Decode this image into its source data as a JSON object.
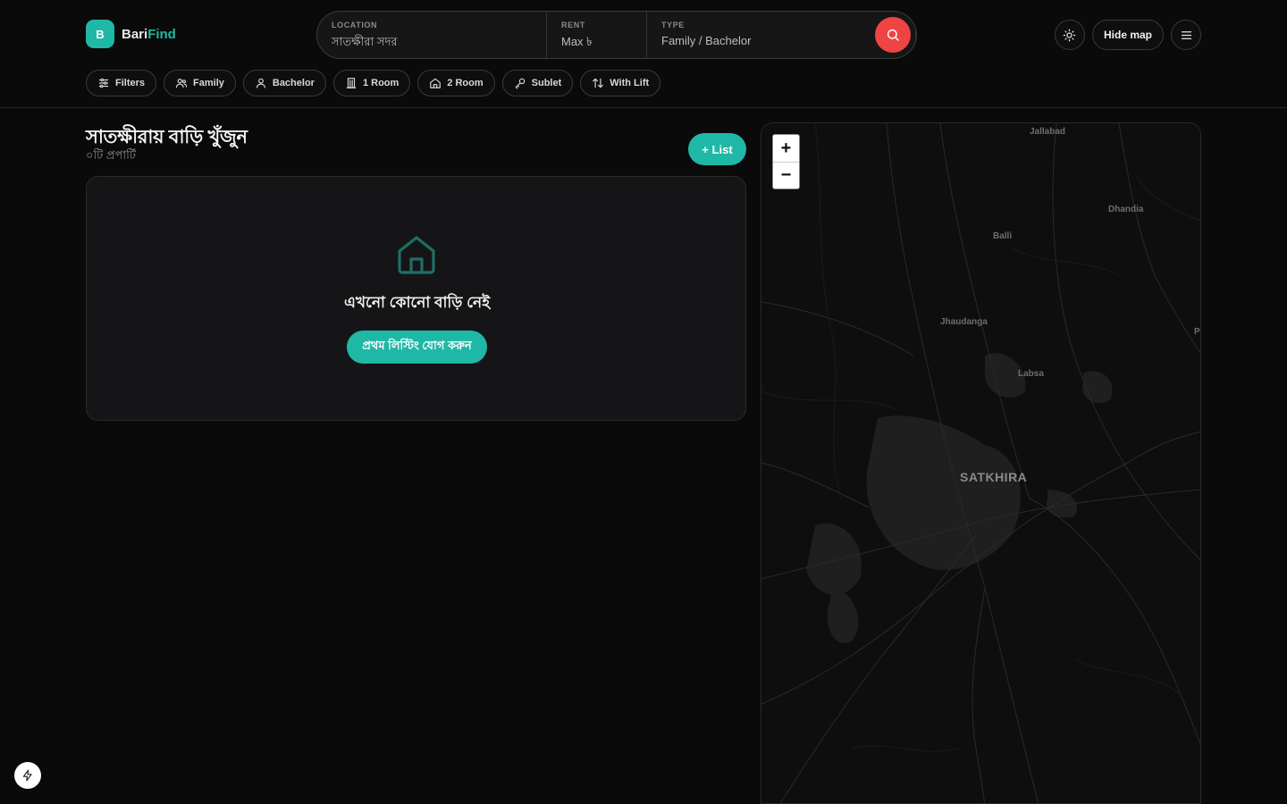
{
  "brand": {
    "initial": "B",
    "name_part1": "Bari",
    "name_part2": "Find"
  },
  "search": {
    "location": {
      "label": "LOCATION",
      "value": "সাতক্ষীরা সদর"
    },
    "rent": {
      "label": "RENT",
      "value": "Max ৳"
    },
    "type": {
      "label": "TYPE",
      "value": "Family / Bachelor"
    }
  },
  "header": {
    "hide_map_label": "Hide map"
  },
  "chips": [
    {
      "label": "Filters",
      "icon": "sliders-icon"
    },
    {
      "label": "Family",
      "icon": "users-icon"
    },
    {
      "label": "Bachelor",
      "icon": "user-icon"
    },
    {
      "label": "1 Room",
      "icon": "door-icon"
    },
    {
      "label": "2 Room",
      "icon": "home-icon"
    },
    {
      "label": "Sublet",
      "icon": "key-icon"
    },
    {
      "label": "With Lift",
      "icon": "arrows-updown-icon"
    }
  ],
  "main": {
    "title": "সাতক্ষীরায় বাড়ি খুঁজুন",
    "count_text": "০টি প্রপার্টি",
    "list_button": "+ List",
    "empty_title": "এখনো কোনো বাড়ি নেই",
    "empty_cta": "প্রথম লিস্টিং যোগ করুন"
  },
  "map": {
    "zoom_in": "+",
    "zoom_out": "−",
    "places": [
      "Jallabad",
      "Dhandia",
      "Balli",
      "Jhaudanga",
      "Labsa",
      "SATKHIRA",
      "P"
    ]
  },
  "colors": {
    "accent": "#1fb8a6",
    "search_button": "#ef4444",
    "background": "#0a0a0a"
  }
}
